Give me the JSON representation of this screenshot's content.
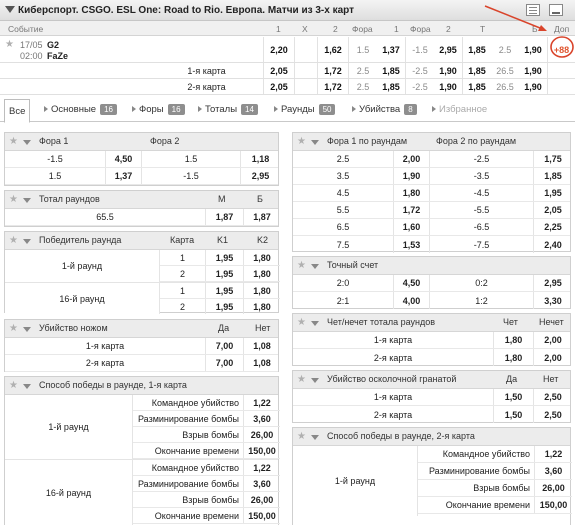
{
  "header": {
    "title": "Киберспорт. CSGO. ESL One: Road to Rio. Европа. Матчи из 3-х карт"
  },
  "columns": {
    "event": "Событие",
    "c1": "1",
    "cx": "X",
    "c2": "2",
    "fora": "Фора",
    "c1b": "1",
    "fora2": "Фора",
    "c2b": "2",
    "t": "Т",
    "b": "Б",
    "dop": "Доп"
  },
  "match": {
    "date": "17/05",
    "time": "02:00",
    "team1": "G2",
    "team2": "FaZe",
    "odds": [
      "2,20",
      "",
      "1,62",
      "1.5",
      "1,37",
      "-1.5",
      "2,95",
      "1,85",
      "2.5",
      "1,90"
    ],
    "extra": "+88"
  },
  "map_rows": [
    {
      "label": "1-я карта",
      "odds": [
        "2,05",
        "",
        "1,72",
        "2.5",
        "1,85",
        "-2.5",
        "1,90",
        "1,85",
        "26.5",
        "1,90"
      ]
    },
    {
      "label": "2-я карта",
      "odds": [
        "2,05",
        "",
        "1,72",
        "2.5",
        "1,85",
        "-2.5",
        "1,90",
        "1,85",
        "26.5",
        "1,90"
      ]
    }
  ],
  "tabs": [
    {
      "label": "Все",
      "badge": ""
    },
    {
      "label": "Основные",
      "badge": "16"
    },
    {
      "label": "Форы",
      "badge": "16"
    },
    {
      "label": "Тоталы",
      "badge": "14"
    },
    {
      "label": "Раунды",
      "badge": "50"
    },
    {
      "label": "Убийства",
      "badge": "8"
    },
    {
      "label": "Избранное",
      "badge": ""
    }
  ],
  "fora": {
    "h1": "Фора 1",
    "h2": "Фора 2",
    "rows": [
      [
        "-1.5",
        "4,50",
        "1.5",
        "1,18"
      ],
      [
        "1.5",
        "1,37",
        "-1.5",
        "2,95"
      ]
    ]
  },
  "total_rounds": {
    "title": "Тотал раундов",
    "m": "М",
    "b": "Б",
    "row": [
      "65.5",
      "1,87",
      "1,87"
    ]
  },
  "round_winner": {
    "title": "Победитель раунда",
    "h_map": "Карта",
    "h_k1": "K1",
    "h_k2": "K2",
    "groups": [
      {
        "label": "1-й раунд",
        "rows": [
          [
            "1",
            "1,95",
            "1,80"
          ],
          [
            "2",
            "1,95",
            "1,80"
          ]
        ]
      },
      {
        "label": "16-й раунд",
        "rows": [
          [
            "1",
            "1,95",
            "1,80"
          ],
          [
            "2",
            "1,95",
            "1,80"
          ]
        ]
      }
    ]
  },
  "knife_kill": {
    "title": "Убийство ножом",
    "yes": "Да",
    "no": "Нет",
    "rows": [
      [
        "1-я карта",
        "7,00",
        "1,08"
      ],
      [
        "2-я карта",
        "7,00",
        "1,08"
      ]
    ]
  },
  "win_method_1": {
    "title": "Способ победы в раунде, 1-я карта",
    "groups": [
      {
        "label": "1-й раунд",
        "rows": [
          [
            "Командное убийство",
            "1,22"
          ],
          [
            "Разминирование бомбы",
            "3,60"
          ],
          [
            "Взрыв бомбы",
            "26,00"
          ],
          [
            "Окончание времени",
            "150,00"
          ]
        ]
      },
      {
        "label": "16-й раунд",
        "rows": [
          [
            "Командное убийство",
            "1,22"
          ],
          [
            "Разминирование бомбы",
            "3,60"
          ],
          [
            "Взрыв бомбы",
            "26,00"
          ],
          [
            "Окончание времени",
            "150,00"
          ]
        ]
      }
    ]
  },
  "fora_rounds": {
    "h1": "Фора 1 по раундам",
    "h2": "Фора 2 по раундам",
    "rows": [
      [
        "2.5",
        "2,00",
        "-2.5",
        "1,75"
      ],
      [
        "3.5",
        "1,90",
        "-3.5",
        "1,85"
      ],
      [
        "4.5",
        "1,80",
        "-4.5",
        "1,95"
      ],
      [
        "5.5",
        "1,72",
        "-5.5",
        "2,05"
      ],
      [
        "6.5",
        "1,60",
        "-6.5",
        "2,25"
      ],
      [
        "7.5",
        "1,53",
        "-7.5",
        "2,40"
      ]
    ]
  },
  "exact_score": {
    "title": "Точный счет",
    "rows": [
      [
        "2:0",
        "4,50",
        "0:2",
        "2,95"
      ],
      [
        "2:1",
        "4,00",
        "1:2",
        "3,30"
      ]
    ]
  },
  "odd_even": {
    "title": "Чет/нечет тотала раундов",
    "h1": "Чет",
    "h2": "Нечет",
    "rows": [
      [
        "1-я карта",
        "1,80",
        "2,00"
      ],
      [
        "2-я карта",
        "1,80",
        "2,00"
      ]
    ]
  },
  "grenade_kill": {
    "title": "Убийство осколочной гранатой",
    "yes": "Да",
    "no": "Нет",
    "rows": [
      [
        "1-я карта",
        "1,50",
        "2,50"
      ],
      [
        "2-я карта",
        "1,50",
        "2,50"
      ]
    ]
  },
  "win_method_2": {
    "title": "Способ победы в раунде, 2-я карта",
    "groups": [
      {
        "label": "1-й раунд",
        "rows": [
          [
            "Командное убийство",
            "1,22"
          ],
          [
            "Разминирование бомбы",
            "3,60"
          ],
          [
            "Взрыв бомбы",
            "26,00"
          ],
          [
            "Окончание времени",
            "150,00"
          ]
        ]
      }
    ]
  },
  "colors": {
    "annotation": "#d9442b",
    "header_bg": "#ececec",
    "badge": "#8e8e8e"
  },
  "icons": {
    "collapse": "triangle-down-icon",
    "favorite": "star-icon",
    "list": "list-icon",
    "minimize": "minimize-icon"
  }
}
